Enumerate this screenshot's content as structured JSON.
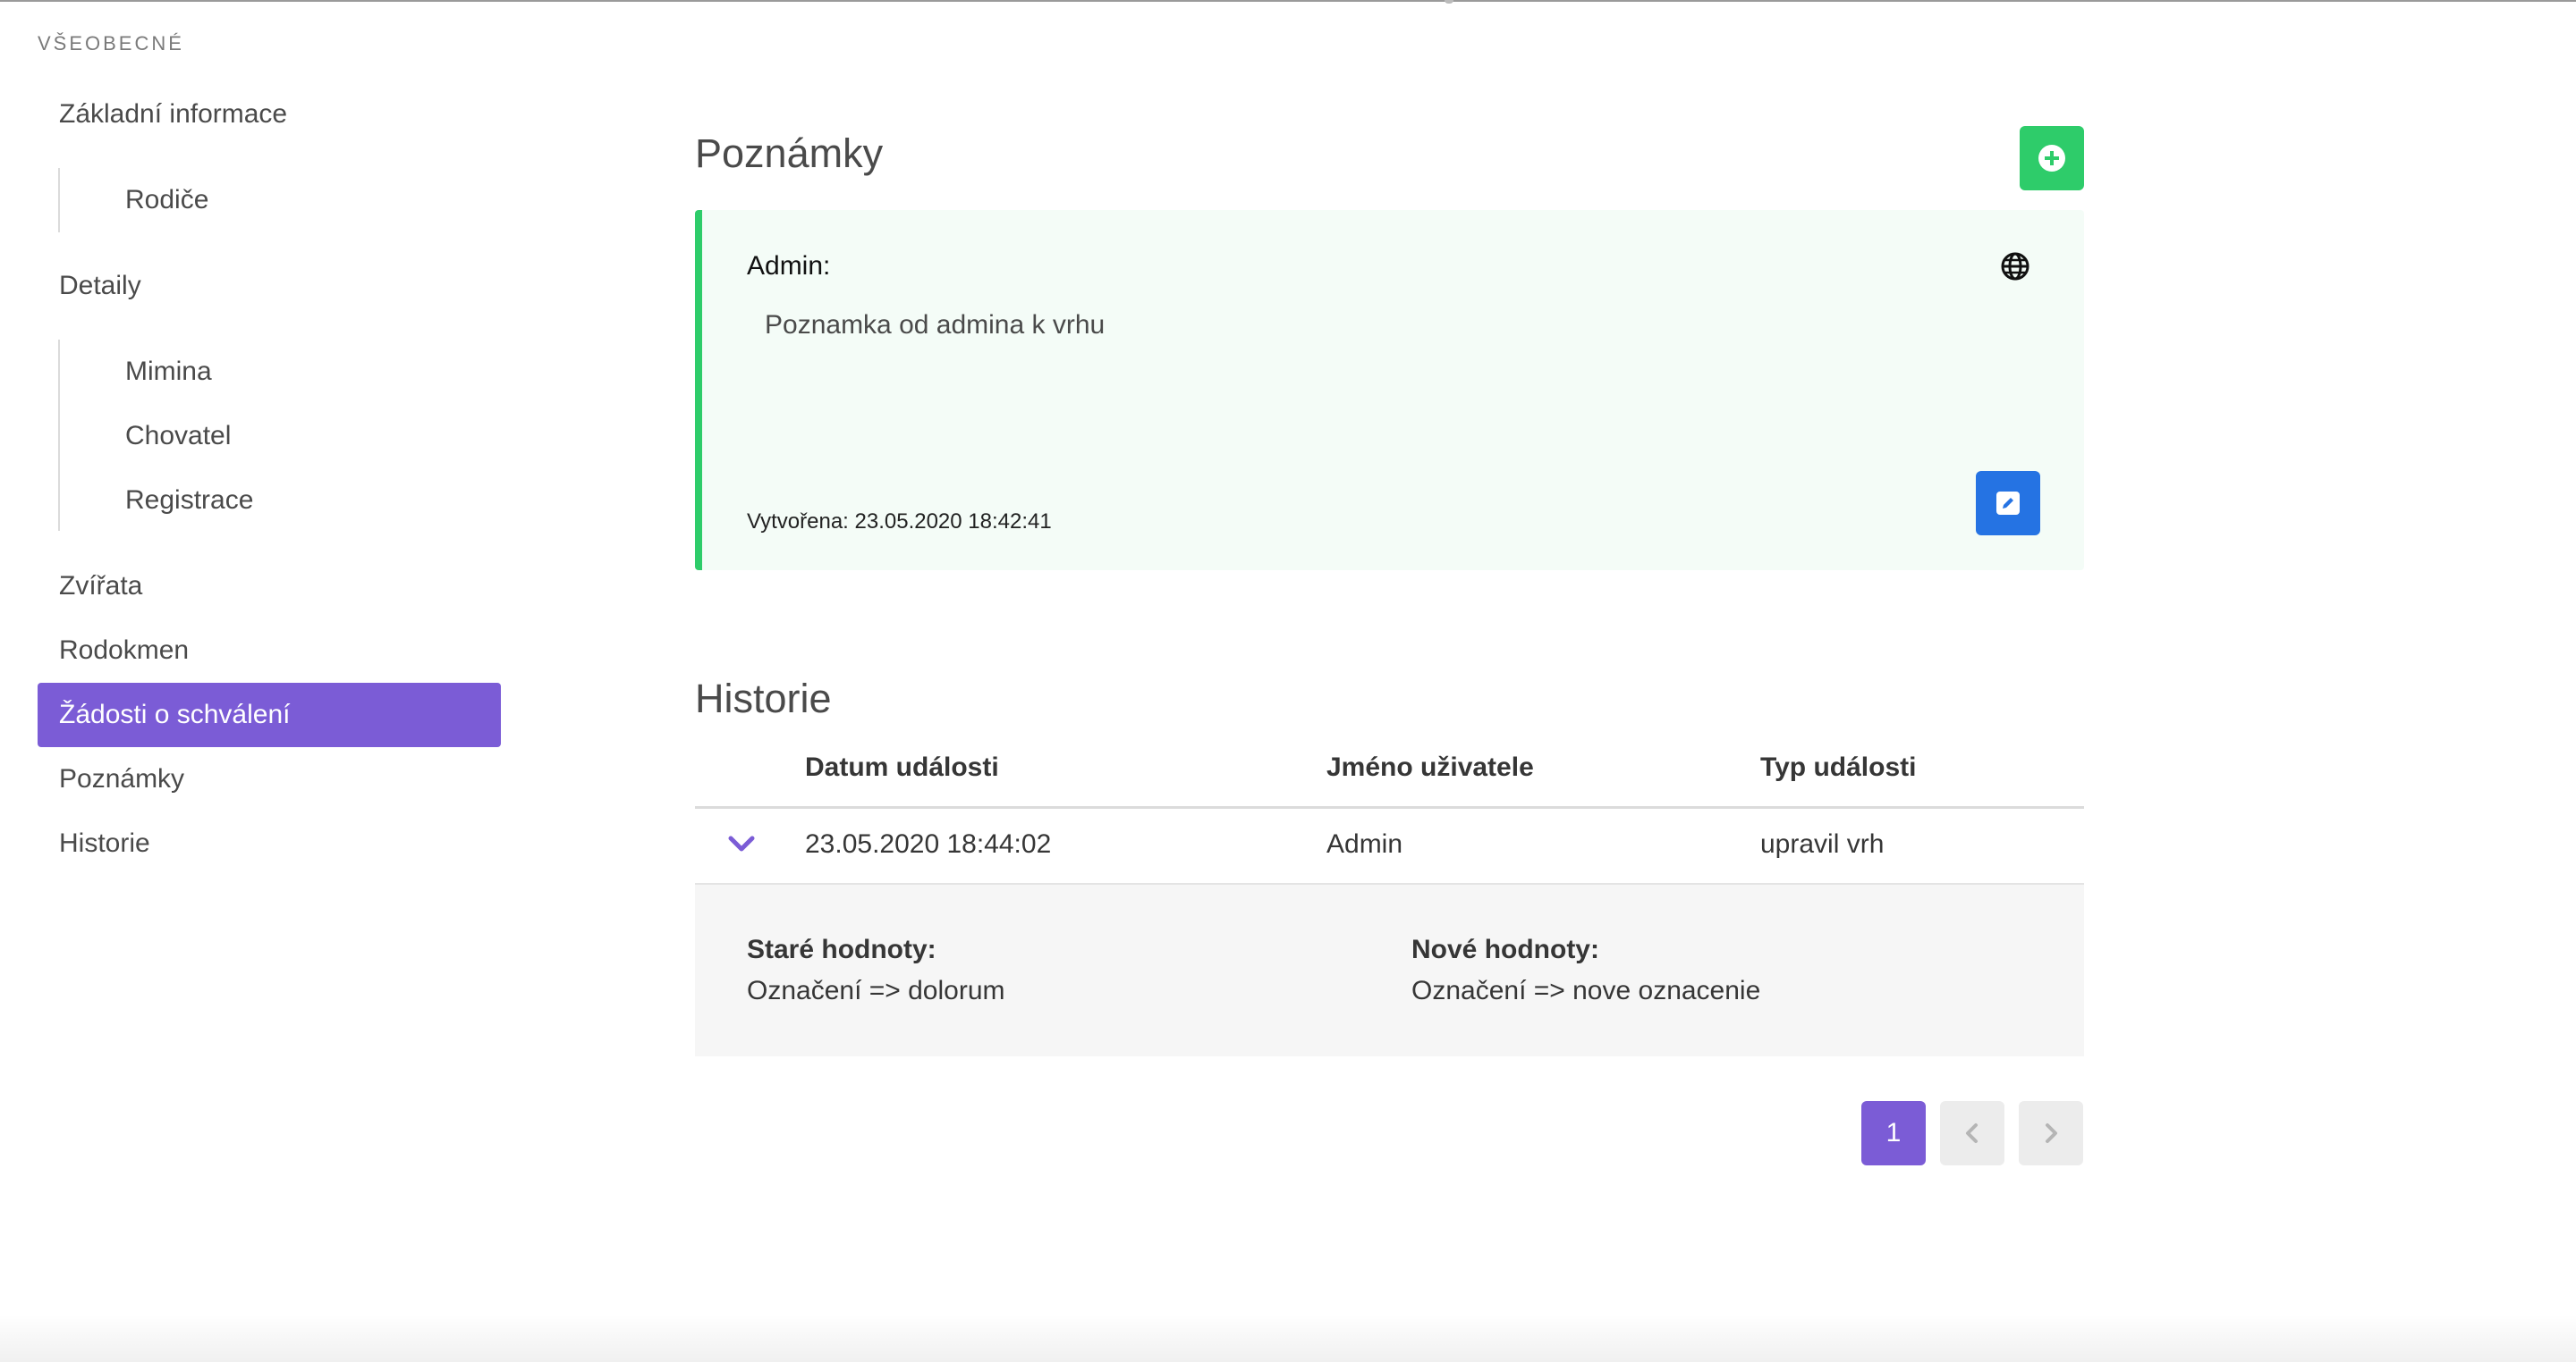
{
  "sidebar": {
    "label": "VŠEOBECNÉ",
    "items": [
      {
        "label": "Základní informace"
      },
      {
        "label": "Rodiče"
      },
      {
        "label": "Detaily"
      },
      {
        "label": "Mimina"
      },
      {
        "label": "Chovatel"
      },
      {
        "label": "Registrace"
      },
      {
        "label": "Zvířata"
      },
      {
        "label": "Rodokmen"
      },
      {
        "label": "Žádosti o schválení",
        "active": true
      },
      {
        "label": "Poznámky"
      },
      {
        "label": "Historie"
      }
    ]
  },
  "notes": {
    "title": "Poznámky",
    "add_icon": "plus-circle-icon",
    "note": {
      "author": "Admin:",
      "text": "Poznamka od admina k vrhu",
      "created": "Vytvořena: 23.05.2020 18:42:41",
      "visibility_icon": "globe-icon",
      "edit_icon": "edit-icon"
    }
  },
  "history": {
    "title": "Historie",
    "columns": [
      "Datum události",
      "Jméno uživatele",
      "Typ události"
    ],
    "rows": [
      {
        "date": "23.05.2020 18:44:02",
        "user": "Admin",
        "type": "upravil vrh",
        "expanded": true
      }
    ],
    "detail": {
      "old_label": "Staré hodnoty:",
      "old_value": "Označení => dolorum",
      "new_label": "Nové hodnoty:",
      "new_value": "Označení => nove oznacenie"
    }
  },
  "pagination": {
    "current": "1",
    "prev_icon": "chevron-left-icon",
    "next_icon": "chevron-right-icon"
  },
  "colors": {
    "accent": "#7b5cd6",
    "success": "#2ecc6a",
    "info": "#2573e3"
  }
}
